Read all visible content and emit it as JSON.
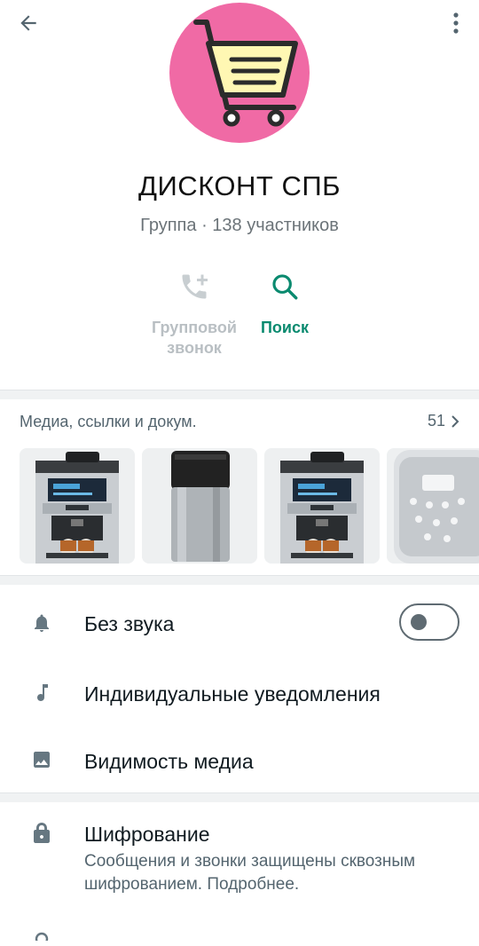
{
  "header": {
    "back_icon": "arrow-left-icon",
    "menu_icon": "more-vertical-icon",
    "avatar_icon": "shopping-cart-icon",
    "avatar_color": "#f06aa5"
  },
  "group": {
    "title": "ДИСКОНТ СПБ",
    "subtitle": "Группа · 138 участников"
  },
  "actions": {
    "call_label": "Групповой звонок",
    "search_label": "Поиск",
    "accent_color": "#0a8a6f"
  },
  "media": {
    "title": "Медиа, ссылки и докум.",
    "count": "51",
    "thumbnails": [
      "coffee-machine",
      "milk-container",
      "coffee-machine",
      "bork-multicooker"
    ]
  },
  "settings": {
    "mute_label": "Без звука",
    "mute_on": false,
    "notifications_label": "Индивидуальные уведомления",
    "media_visibility_label": "Видимость медиа",
    "encryption_label": "Шифрование",
    "encryption_desc": "Сообщения и звонки защищены сквозным шифрованием. Подробнее."
  }
}
